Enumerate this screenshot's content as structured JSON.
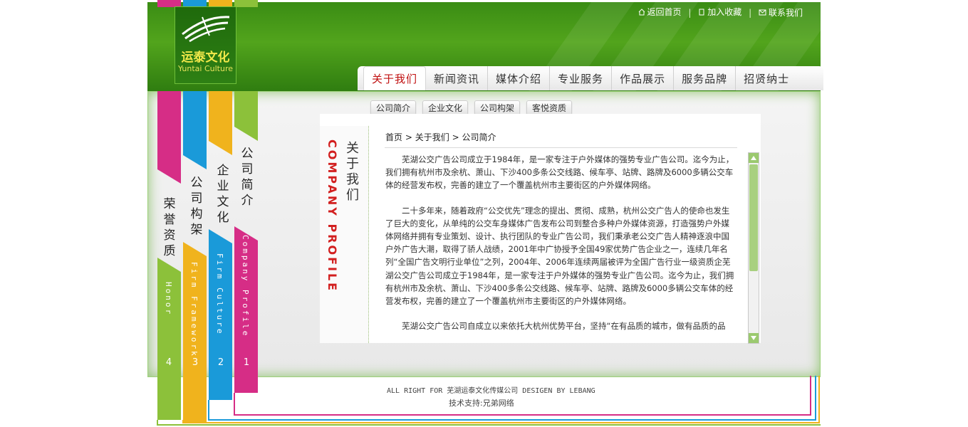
{
  "logo": {
    "name_cn": "运泰文化",
    "name_en": "Yuntai Culture"
  },
  "toplinks": [
    {
      "label": "返回首页",
      "icon": "home-icon"
    },
    {
      "label": "加入收藏",
      "icon": "document-icon"
    },
    {
      "label": "联系我们",
      "icon": "mail-icon"
    }
  ],
  "toplinks_separator": "|",
  "nav": [
    {
      "label": "关于我们",
      "active": true
    },
    {
      "label": "新闻资讯"
    },
    {
      "label": "媒体介绍"
    },
    {
      "label": "专业服务"
    },
    {
      "label": "作品展示"
    },
    {
      "label": "服务品牌"
    },
    {
      "label": "招贤纳士"
    }
  ],
  "subnav": [
    "公司简介",
    "企业文化",
    "公司构架",
    "客悦资质"
  ],
  "side_title": {
    "cn": "关于我们",
    "en": "COMPANY PROFILE"
  },
  "breadcrumb": {
    "home": "首页",
    "section": "关于我们",
    "page": "公司简介",
    "sep": ">"
  },
  "article": [
    "芜湖公交广告公司成立于1984年，是一家专注于户外媒体的强势专业广告公司。迄今为止，我们拥有杭州市及余杭、萧山、下沙400多条公交线路、候车亭、站牌、路牌及6000多辆公交车体的经营发布权，完善的建立了一个覆盖杭州市主要街区的户外媒体网络。",
    "二十多年来，随着政府“公交优先”理念的提出、贯彻、成熟，杭州公交广告人的使命也发生了巨大的变化，从单纯的公交车身媒体广告发布公司到整合多种户外媒体资源，打造强势户外媒体网络并拥有专业策划、设计、执行团队的专业广告公司，我们秉承老公交广告人精神逐浪中国户外广告大潮，取得了骄人战绩，2001年中广协授予全国49家优势广告企业之一，连续几年名列“全国广告文明行业单位”之列，2004年、2006年连续两届被评为全国广告行业一级资质企芜湖公交广告公司成立于1984年，是一家专注于户外媒体的强势专业广告公司。迄今为止，我们拥有杭州市及余杭、萧山、下沙400多条公交线路、候车亭、站牌、路牌及6000多辆公交车体的经营发布权，完善的建立了一个覆盖杭州市主要街区的户外媒体网络。",
    "芜湖公交广告公司自成立以来依托大杭州优势平台，坚持“在有品质的城市，做有品质的品"
  ],
  "ribbons": [
    {
      "cn": "公司简介",
      "en": "Company Profile",
      "num": "1",
      "color": "#d62d86"
    },
    {
      "cn": "企业文化",
      "en": "Firm Culture",
      "num": "2",
      "color": "#1a9ad9"
    },
    {
      "cn": "公司构架",
      "en": "Firm Framework",
      "num": "3",
      "color": "#f0b31d"
    },
    {
      "cn": "荣誉资质",
      "en": "Honor",
      "num": "4",
      "color": "#8cc13a"
    }
  ],
  "footer": {
    "copyright": "ALL RIGHT FOR 芜湖运泰文化传媒公司 DESIGEN BY LEBANG",
    "tech": "技术支持:兄弟网络"
  }
}
